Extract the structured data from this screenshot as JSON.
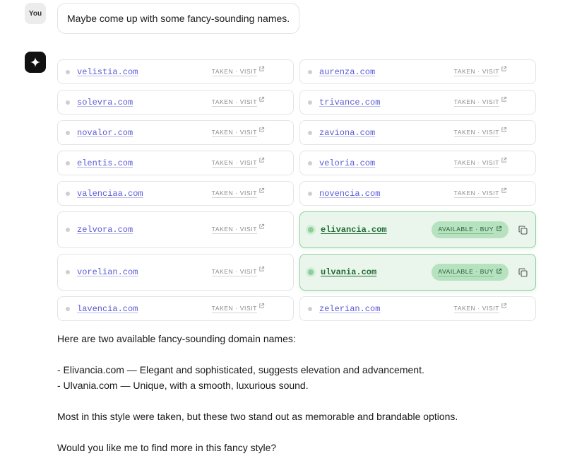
{
  "user": {
    "avatar_label": "You",
    "message": "Maybe come up with some fancy-sounding names."
  },
  "assistant": {
    "avatar_icon": "sparkle-icon",
    "domains": [
      [
        {
          "name": "velistia.com",
          "status": "TAKEN · VISIT",
          "available": false
        },
        {
          "name": "aurenza.com",
          "status": "TAKEN · VISIT",
          "available": false
        }
      ],
      [
        {
          "name": "solevra.com",
          "status": "TAKEN · VISIT",
          "available": false
        },
        {
          "name": "trivance.com",
          "status": "TAKEN · VISIT",
          "available": false
        }
      ],
      [
        {
          "name": "novalor.com",
          "status": "TAKEN · VISIT",
          "available": false
        },
        {
          "name": "zaviona.com",
          "status": "TAKEN · VISIT",
          "available": false
        }
      ],
      [
        {
          "name": "elentis.com",
          "status": "TAKEN · VISIT",
          "available": false
        },
        {
          "name": "veloria.com",
          "status": "TAKEN · VISIT",
          "available": false
        }
      ],
      [
        {
          "name": "valenciaa.com",
          "status": "TAKEN · VISIT",
          "available": false
        },
        {
          "name": "novencia.com",
          "status": "TAKEN · VISIT",
          "available": false
        }
      ],
      [
        {
          "name": "zelvora.com",
          "status": "TAKEN · VISIT",
          "available": false
        },
        {
          "name": "elivancia.com",
          "status": "AVAILABLE · BUY",
          "available": true
        }
      ],
      [
        {
          "name": "vorelian.com",
          "status": "TAKEN · VISIT",
          "available": false
        },
        {
          "name": "ulvania.com",
          "status": "AVAILABLE · BUY",
          "available": true
        }
      ],
      [
        {
          "name": "lavencia.com",
          "status": "TAKEN · VISIT",
          "available": false
        },
        {
          "name": "zelerian.com",
          "status": "TAKEN · VISIT",
          "available": false
        }
      ]
    ],
    "reply": {
      "intro": "Here are two available fancy-sounding domain names:",
      "bullets": [
        "- Elivancia.com — Elegant and sophisticated, suggests elevation and advancement.",
        "- Ulvania.com — Unique, with a smooth, luxurious sound."
      ],
      "summary": "Most in this style were taken, but these two stand out as memorable and brandable options.",
      "question": "Would you like me to find more in this fancy style?"
    }
  },
  "colors": {
    "link": "#5b5bd6",
    "available_bg": "#eaf6ec",
    "available_border": "#8fd19c",
    "buy_pill": "#b6e2bf"
  }
}
